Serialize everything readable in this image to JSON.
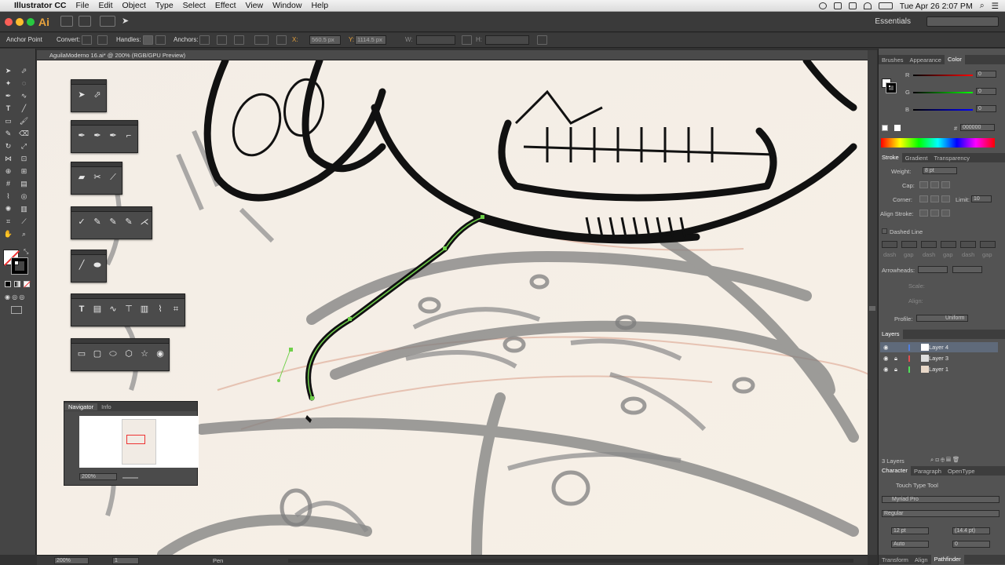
{
  "menubar": {
    "apple": "",
    "app_name": "Illustrator CC",
    "items": [
      "File",
      "Edit",
      "Object",
      "Type",
      "Select",
      "Effect",
      "View",
      "Window",
      "Help"
    ],
    "clock": "Tue Apr 26  2:07 PM"
  },
  "appbar": {
    "logo": "Ai",
    "workspace": "Essentials"
  },
  "control": {
    "tool_name": "Anchor Point",
    "convert": "Convert:",
    "handles": "Handles:",
    "anchors": "Anchors:",
    "x_label": "X:",
    "x_value": "560.5 px",
    "y_label": "Y:",
    "y_value": "1114.5 px",
    "w_label": "W:",
    "h_label": "H:"
  },
  "document": {
    "tab_title": "AguilaModerno 16.ai* @ 200% (RGB/GPU Preview)",
    "zoom": "200%",
    "artboard": "1",
    "status_tool": "Pen"
  },
  "navigator": {
    "tabs": [
      "Navigator",
      "Info"
    ],
    "zoom": "200%"
  },
  "color_panel": {
    "tabs": [
      "Brushes",
      "Appearance",
      "Color"
    ],
    "r_label": "R",
    "g_label": "G",
    "b_label": "B",
    "r": "0",
    "g": "0",
    "b": "0",
    "hex": "000000",
    "hex_symbol": "#"
  },
  "stroke_panel": {
    "tabs": [
      "Stroke",
      "Gradient",
      "Transparency"
    ],
    "weight_label": "Weight:",
    "weight": "8 pt",
    "cap_label": "Cap:",
    "corner_label": "Corner:",
    "limit_label": "Limit:",
    "limit": "10",
    "align_label": "Align Stroke:",
    "dashed_line": "Dashed Line",
    "dash_labels": [
      "dash",
      "gap",
      "dash",
      "gap",
      "dash",
      "gap"
    ],
    "arrowheads_label": "Arrowheads:",
    "scale_label": "Scale:",
    "align2_label": "Align:",
    "profile_label": "Profile:",
    "profile": "Uniform"
  },
  "layers_panel": {
    "tab": "Layers",
    "layers": [
      {
        "name": "Layer 4",
        "color": "#4f7fe0"
      },
      {
        "name": "Layer 3",
        "color": "#e04f4f"
      },
      {
        "name": "Layer 1",
        "color": "#4fe05a"
      }
    ],
    "count": "3 Layers"
  },
  "character_panel": {
    "tabs": [
      "Character",
      "Paragraph",
      "OpenType"
    ],
    "touch_type": "Touch Type Tool",
    "font": "Myriad Pro",
    "style": "Regular",
    "size": "12 pt",
    "leading": "(14.4 pt)",
    "kerning": "Auto",
    "tracking": "0"
  },
  "bottom_tabs": [
    "Transform",
    "Align",
    "Pathfinder"
  ],
  "colors": {
    "accent": "#e8a33d",
    "path_highlight": "#6fd04a",
    "canvas": "#f4eee7"
  }
}
